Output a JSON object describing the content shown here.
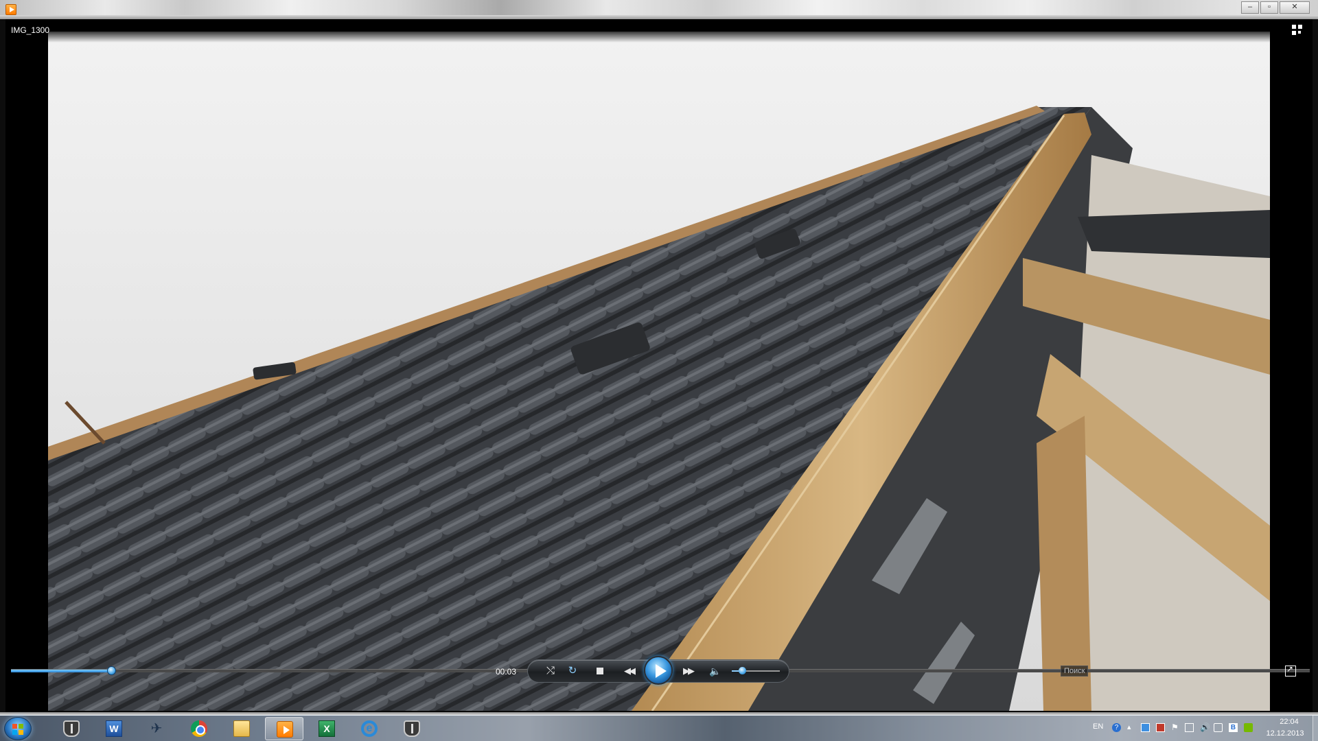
{
  "window": {
    "minimize_glyph": "–",
    "maximize_glyph": "▫",
    "close_glyph": "✕"
  },
  "player": {
    "title": "IMG_1300",
    "time_elapsed": "00:03",
    "seek_progress": 0.077,
    "volume_level": 0.22,
    "search_tooltip": "Поиск",
    "shuffle_glyph": "⤭",
    "repeat_glyph": "↻",
    "prev_glyph": "◀◀",
    "next_glyph": "▶▶",
    "mute_glyph": "🔈"
  },
  "taskbar": {
    "items": [
      {
        "name": "World of Tanks",
        "icon": "tank-icon"
      },
      {
        "name": "Microsoft Word",
        "icon": "word-icon",
        "glyph": "W"
      },
      {
        "name": "World of Warplanes",
        "icon": "wings-icon",
        "glyph": "✈"
      },
      {
        "name": "Google Chrome",
        "icon": "chrome-icon"
      },
      {
        "name": "Windows Explorer",
        "icon": "folder-icon"
      },
      {
        "name": "Windows Media Player",
        "icon": "media-player-icon",
        "active": true
      },
      {
        "name": "Microsoft Excel",
        "icon": "excel-icon",
        "glyph": "X"
      },
      {
        "name": "Internet Explorer",
        "icon": "ie-icon",
        "glyph": "e"
      },
      {
        "name": "World of Tanks",
        "icon": "tank-icon"
      }
    ],
    "tray": {
      "language": "EN",
      "time": "22:04",
      "date": "12.12.2013"
    }
  },
  "colors": {
    "accent": "#3a98e0",
    "sky": "#e8e8e8",
    "tile": "#3c3f44",
    "wood": "#c9a56a"
  }
}
